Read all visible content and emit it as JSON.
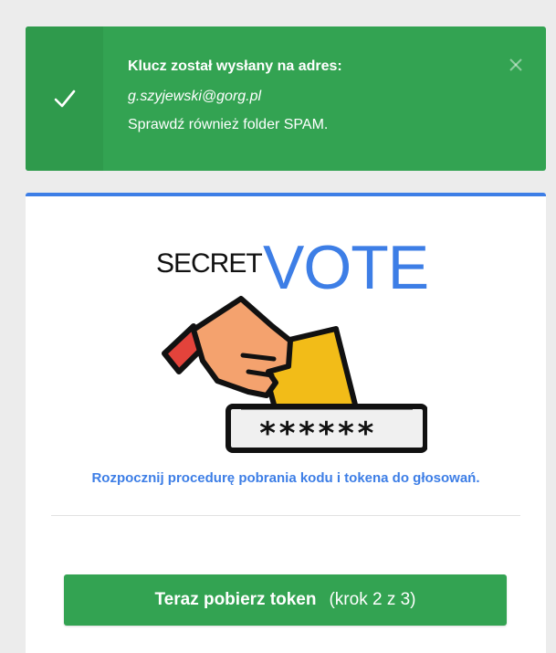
{
  "alert": {
    "title": "Klucz został wysłany na adres:",
    "email": "g.szyjewski@gorg.pl",
    "note": "Sprawdź również folder SPAM.",
    "icon": "check-icon",
    "close_icon": "close-icon"
  },
  "logo": {
    "secret": "SECRET",
    "vote": "VOTE",
    "password": "******_"
  },
  "main": {
    "intro": "Rozpocznij procedurę pobrania kodu i tokena do głosowań.",
    "button_label": "Teraz pobierz token",
    "button_step": "(krok 2 z 3)"
  },
  "colors": {
    "success": "#33a352",
    "accent": "#3d7ee6",
    "background": "#ececec"
  }
}
